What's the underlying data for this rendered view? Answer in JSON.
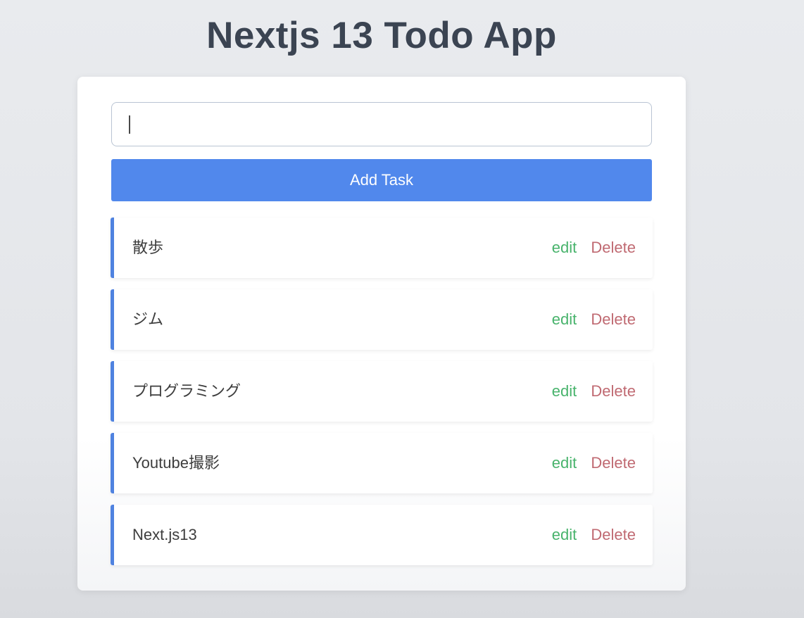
{
  "header": {
    "title": "Nextjs 13 Todo App"
  },
  "form": {
    "input_value": "",
    "add_button_label": "Add Task"
  },
  "tasks": [
    {
      "text": "散歩",
      "edit_label": "edit",
      "delete_label": "Delete"
    },
    {
      "text": "ジム",
      "edit_label": "edit",
      "delete_label": "Delete"
    },
    {
      "text": "プログラミング",
      "edit_label": "edit",
      "delete_label": "Delete"
    },
    {
      "text": "Youtube撮影",
      "edit_label": "edit",
      "delete_label": "Delete"
    },
    {
      "text": "Next.js13",
      "edit_label": "edit",
      "delete_label": "Delete"
    }
  ],
  "colors": {
    "accent": "#5188ec",
    "edit": "#48b36c",
    "delete": "#c06a72",
    "title": "#3b4452"
  }
}
